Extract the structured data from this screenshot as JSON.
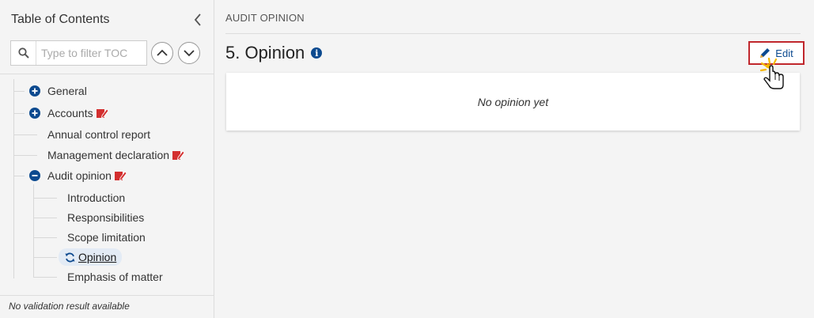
{
  "sidebar": {
    "title": "Table of Contents",
    "filter_placeholder": "Type to filter TOC",
    "items": [
      {
        "label": "General"
      },
      {
        "label": "Accounts"
      },
      {
        "label": "Annual control report"
      },
      {
        "label": "Management declaration"
      },
      {
        "label": "Audit opinion"
      },
      {
        "label": "Introduction"
      },
      {
        "label": "Responsibilities"
      },
      {
        "label": "Scope limitation"
      },
      {
        "label": "Opinion"
      },
      {
        "label": "Emphasis of matter"
      }
    ],
    "validation_text": "No validation result available"
  },
  "main": {
    "breadcrumb": "AUDIT OPINION",
    "section_title": "5. Opinion",
    "edit_label": "Edit",
    "empty_text": "No opinion yet"
  },
  "colors": {
    "accent": "#0c4a8f",
    "flag": "#d32f2f",
    "edit_border": "#c0272d",
    "selected_bg": "#e3ebf5"
  }
}
